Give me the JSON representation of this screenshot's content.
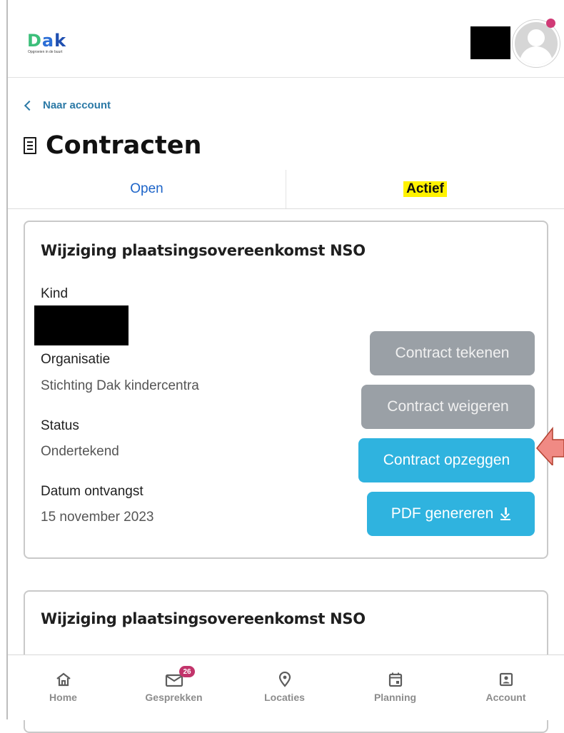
{
  "header": {
    "logo_text": "Dak",
    "logo_tagline": "Opgroeien in de buurt",
    "avatar_icon": "user-avatar-icon",
    "notification_color": "#d03a76"
  },
  "nav": {
    "back_label": "Naar account"
  },
  "page": {
    "title": "Contracten",
    "title_icon": "document-list-icon"
  },
  "tabs": {
    "open_label": "Open",
    "actief_label": "Actief",
    "active_tab": "Actief"
  },
  "contracts": [
    {
      "title": "Wijziging plaatsingsovereenkomst NSO",
      "kind_label": "Kind",
      "organisatie_label": "Organisatie",
      "organisatie_value": "Stichting Dak kindercentra",
      "status_label": "Status",
      "status_value": "Ondertekend",
      "datum_label": "Datum ontvangst",
      "datum_value": "15 november 2023",
      "buttons": {
        "sign": "Contract tekenen",
        "refuse": "Contract weigeren",
        "cancel": "Contract opzeggen",
        "pdf": "PDF genereren"
      }
    },
    {
      "title": "Wijziging plaatsingsovereenkomst NSO"
    }
  ],
  "bottom_nav": [
    {
      "label": "Home",
      "icon": "home-icon"
    },
    {
      "label": "Gesprekken",
      "icon": "mail-icon",
      "badge": "26"
    },
    {
      "label": "Locaties",
      "icon": "location-pin-icon"
    },
    {
      "label": "Planning",
      "icon": "calendar-icon"
    },
    {
      "label": "Account",
      "icon": "account-icon"
    }
  ],
  "colors": {
    "primary_button": "#2fb3df",
    "disabled_button": "#9aa0a6",
    "link": "#2b79a6",
    "highlight": "#fff200",
    "badge": "#c2346b",
    "annotation_arrow": "#f08a84"
  }
}
